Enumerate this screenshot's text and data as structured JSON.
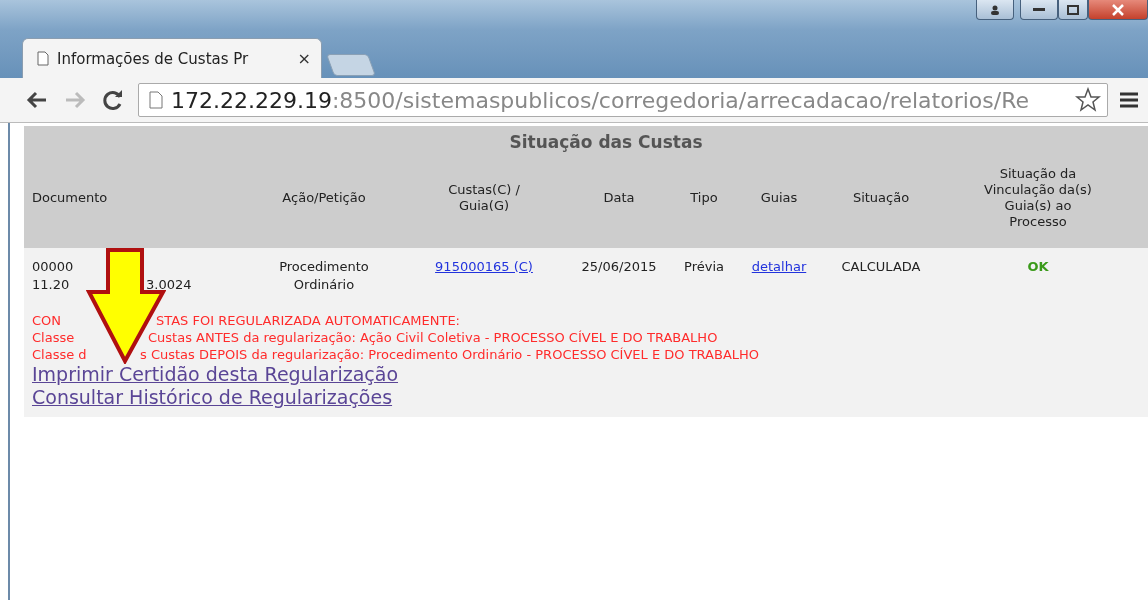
{
  "window": {
    "buttons": [
      {
        "kind": "user"
      },
      {
        "kind": "minimize"
      },
      {
        "kind": "maximize"
      },
      {
        "kind": "close"
      }
    ]
  },
  "tabs": [
    {
      "title": "Informações de Custas Pr",
      "selected": true,
      "close": "×"
    }
  ],
  "toolbar": {
    "back_disabled": false,
    "forward_disabled": true,
    "url_host": "172.22.229.19",
    "url_rest": ":8500/sistemaspublicos/corregedoria/arrecadacao/relatorios/Re"
  },
  "page": {
    "title": "Situação das Custas",
    "columns": [
      "Documento",
      "Ação/Petição",
      "Custas(C) / Guia(G)",
      "Data",
      "Tipo",
      "Guias",
      "Situação",
      "Situação da Vinculação da(s) Guia(s) ao Processo"
    ],
    "row": {
      "document_line_1": "00000",
      "document_line_2_start": "11.20",
      "document_line_2_end": "3.0024",
      "acao": "Procedimento Ordinário",
      "custas_link": "915000165 (C)",
      "data": "25/06/2015",
      "tipo": "Prévia",
      "guias_link": "detalhar",
      "situacao": "CALCULADA",
      "vinculacao": "OK"
    },
    "notice": [
      {
        "start": "CON",
        "end": "STAS FOI REGULARIZADA AUTOMATICAMENTE:"
      },
      {
        "start": "Classe",
        "end": "Custas ANTES da regularização: Ação Civil Coletiva - PROCESSO CÍVEL E DO TRABALHO"
      },
      {
        "start": "Classe d",
        "end": "s Custas DEPOIS da regularização: Procedimento Ordinário - PROCESSO CÍVEL E DO TRABALHO"
      }
    ],
    "links": [
      "Imprimir Certidão desta Regularização",
      "Consultar Histórico de Regularizações"
    ]
  }
}
